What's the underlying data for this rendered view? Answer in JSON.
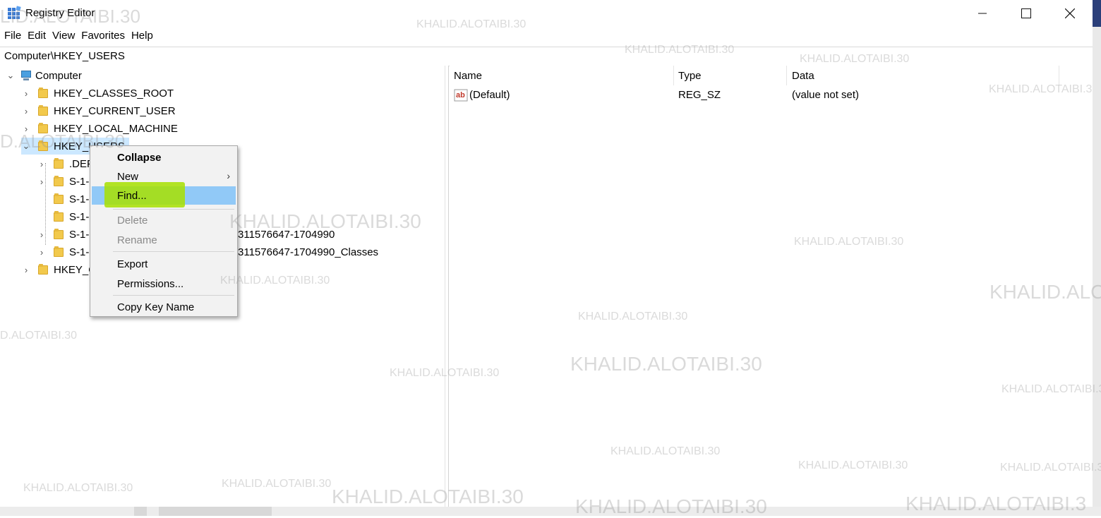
{
  "window": {
    "title": "Registry Editor"
  },
  "menu": [
    "File",
    "Edit",
    "View",
    "Favorites",
    "Help"
  ],
  "address": "Computer\\HKEY_USERS",
  "tree": {
    "root": "Computer",
    "keys": [
      "HKEY_CLASSES_ROOT",
      "HKEY_CURRENT_USER",
      "HKEY_LOCAL_MACHINE",
      "HKEY_USERS"
    ],
    "hkey_users_children": [
      ".DEF",
      "S-1-",
      "S-1-",
      "S-1-",
      "S-1-",
      "S-1-"
    ],
    "child_suffix_4": "311576647-1704990",
    "child_suffix_5": "311576647-1704990_Classes",
    "last_key": "HKEY_C"
  },
  "list": {
    "columns": {
      "name": "Name",
      "type": "Type",
      "data": "Data"
    },
    "rows": [
      {
        "name": "(Default)",
        "type": "REG_SZ",
        "data": "(value not set)"
      }
    ]
  },
  "context_menu": {
    "collapse": "Collapse",
    "new": "New",
    "find": "Find...",
    "delete": "Delete",
    "rename": "Rename",
    "export": "Export",
    "permissions": "Permissions...",
    "copy_key_name": "Copy Key Name"
  },
  "watermark_text": "KHALID.ALOTAIBI.30",
  "watermark_partial_left": "D.ALOTAIBI.30",
  "watermark_partial_title": "LID.ALOTAIBI.30",
  "watermark_partial_right": "KHALID.ALOTAIBI.3",
  "colors": {
    "selection": "#cce8ff",
    "menu_highlight": "#91c9f7",
    "marker": "#a7e100"
  }
}
